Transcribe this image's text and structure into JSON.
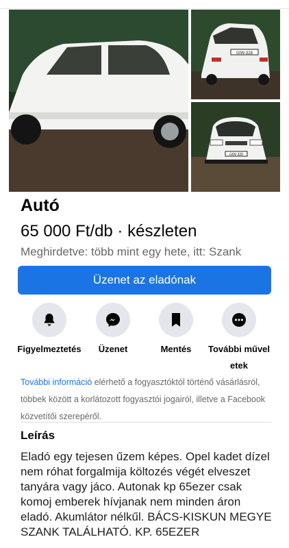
{
  "listing": {
    "title": "Autó",
    "price_line": "65 000 Ft/db · készleten",
    "meta": "Meghirdetve: több mint egy hete, itt: Szank",
    "message_button": "Üzenet az eladónak",
    "plate_text": "GIW-328"
  },
  "actions": [
    {
      "label": "Figyelmeztetés",
      "icon": "bell-icon"
    },
    {
      "label": "Üzenet",
      "icon": "messenger-icon"
    },
    {
      "label": "Mentés",
      "icon": "bookmark-icon"
    },
    {
      "label": "További műveletek",
      "icon": "more-icon"
    }
  ],
  "info": {
    "link": "További információ",
    "rest": " elérhető a fogyasztóktól történő vásárlásról, többek között a korlátozott fogyasztói jogairól, illetve a Facebook közvetítői szerepéről."
  },
  "description": {
    "heading": "Leírás",
    "text": "Eladó egy tejesen űzem képes. Opel kadet dízel nem róhat forgalmija költozés végét elveszet tanyára vagy  jáco. Autonak kp 65ezer csak komoj emberek hívjanak nem minden áron eladó. Akumlátor nélkűl. BÁCS-KISKUN MEGYE SZANK TALÁLHATÓ. KP. 65EZER"
  },
  "colors": {
    "accent": "#1b74e4",
    "secondary_text": "#65676b",
    "icon_circle": "#e4e6eb"
  }
}
